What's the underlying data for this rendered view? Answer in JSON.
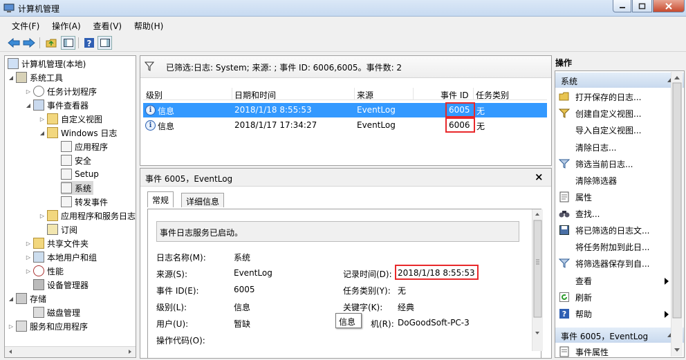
{
  "window": {
    "title": "计算机管理"
  },
  "menu": [
    "文件(F)",
    "操作(A)",
    "查看(V)",
    "帮助(H)"
  ],
  "tree": {
    "root": "计算机管理(本地)",
    "system_tools": "系统工具",
    "task_scheduler": "任务计划程序",
    "event_viewer": "事件查看器",
    "custom_views": "自定义视图",
    "windows_logs": "Windows 日志",
    "application": "应用程序",
    "security": "安全",
    "setup": "Setup",
    "system": "系统",
    "forwarded": "转发事件",
    "app_service_logs": "应用程序和服务日志",
    "subscriptions": "订阅",
    "shared_folders": "共享文件夹",
    "local_users": "本地用户和组",
    "performance": "性能",
    "device_manager": "设备管理器",
    "storage": "存储",
    "disk_management": "磁盘管理",
    "services_apps": "服务和应用程序"
  },
  "filter_text": "已筛选:日志: System; 来源: ; 事件 ID: 6006,6005。事件数: 2",
  "columns": [
    "级别",
    "日期和时间",
    "来源",
    "事件 ID",
    "任务类别"
  ],
  "events": [
    {
      "level": "信息",
      "datetime": "2018/1/18 8:55:53",
      "source": "EventLog",
      "id": "6005",
      "category": "无"
    },
    {
      "level": "信息",
      "datetime": "2018/1/17 17:34:27",
      "source": "EventLog",
      "id": "6006",
      "category": "无"
    }
  ],
  "detail": {
    "header": "事件 6005，EventLog",
    "close": "×",
    "tabs": [
      "常规",
      "详细信息"
    ],
    "message": "事件日志服务已启动。",
    "fields": {
      "log_name_label": "日志名称(M):",
      "log_name": "系统",
      "source_label": "来源(S):",
      "source": "EventLog",
      "logged_label": "记录时间(D):",
      "logged": "2018/1/18 8:55:53",
      "event_id_label": "事件 ID(E):",
      "event_id": "6005",
      "task_cat_label": "任务类别(Y):",
      "task_cat": "无",
      "level_label": "级别(L):",
      "level": "信息",
      "keywords_label": "关键字(K):",
      "keywords": "经典",
      "user_label": "用户(U):",
      "user": "暂缺",
      "computer_label": "机(R):",
      "computer": "DoGoodSoft-PC-3",
      "opcode_label": "操作代码(O):"
    },
    "tooltip": "信息"
  },
  "actions": {
    "title": "操作",
    "section1": "系统",
    "items1": [
      "打开保存的日志...",
      "创建自定义视图...",
      "导入自定义视图...",
      "清除日志...",
      "筛选当前日志...",
      "清除筛选器",
      "属性",
      "查找...",
      "将已筛选的日志文...",
      "将任务附加到此日...",
      "将筛选器保存到自...",
      "查看",
      "刷新",
      "帮助"
    ],
    "section2": "事件 6005，EventLog",
    "items2": [
      "事件属性"
    ]
  },
  "colors": {
    "selection": "#3399ff",
    "highlight_box": "#e8282a"
  }
}
